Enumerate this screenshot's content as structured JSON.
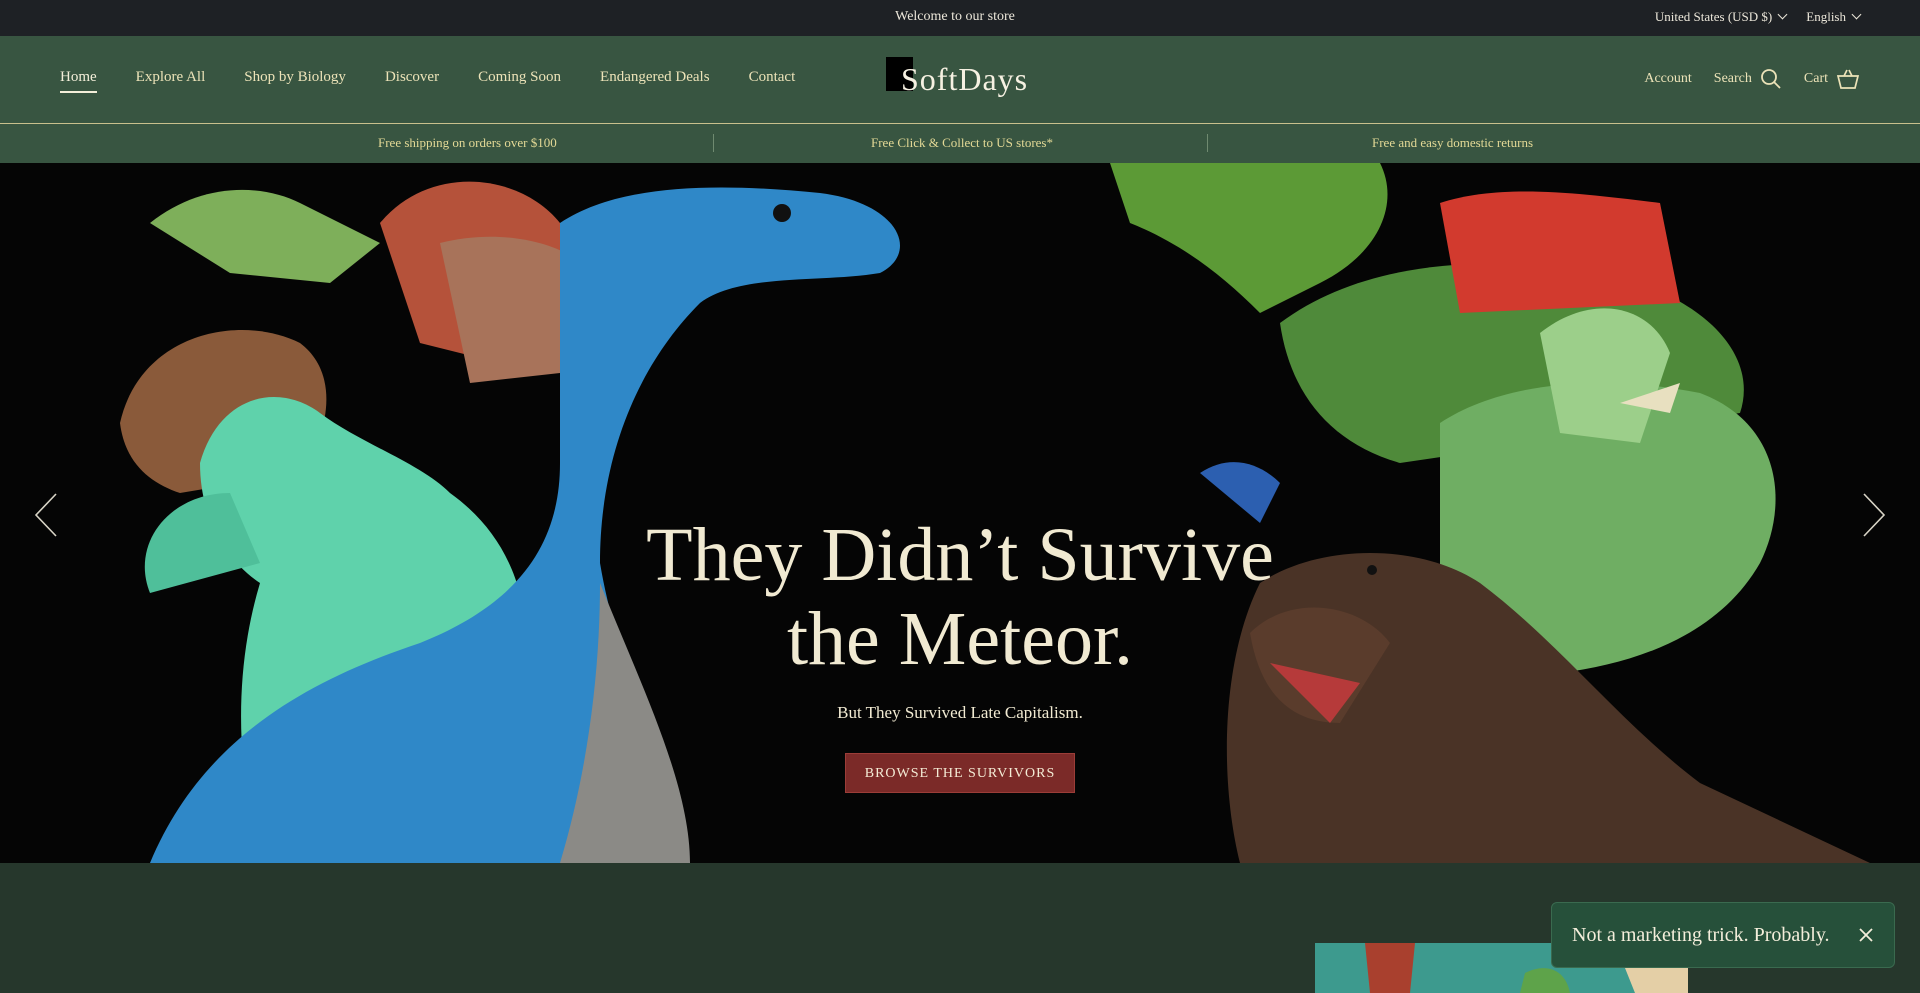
{
  "announcement": {
    "text": "Welcome to our store"
  },
  "locale": {
    "country": "United States (USD $)",
    "language": "English"
  },
  "logo": {
    "text": "SoftDays"
  },
  "nav": {
    "items": [
      "Home",
      "Explore All",
      "Shop by Biology",
      "Discover",
      "Coming Soon",
      "Endangered Deals",
      "Contact"
    ],
    "active": "Home"
  },
  "utility": {
    "account": "Account",
    "search": "Search",
    "cart": "Cart"
  },
  "benefits": [
    "Free shipping on orders over $100",
    "Free Click & Collect to US stores*",
    "Free and easy domestic returns"
  ],
  "hero": {
    "title_line1": "They Didn’t Survive",
    "title_line2": "the Meteor.",
    "subtitle": "But They Survived Late Capitalism.",
    "cta": "BROWSE THE SURVIVORS"
  },
  "toast": {
    "text": "Not a marketing trick. Probably."
  },
  "colors": {
    "topbar": "#1e2125",
    "header": "#385541",
    "nav_text": "#ece3b8",
    "cta": "#7b2a28",
    "page_bg": "#26372c",
    "toast": "#26503a"
  },
  "icons": [
    "chevron-down-icon",
    "search-icon",
    "cart-icon",
    "arrow-left-icon",
    "arrow-right-icon",
    "close-icon"
  ]
}
